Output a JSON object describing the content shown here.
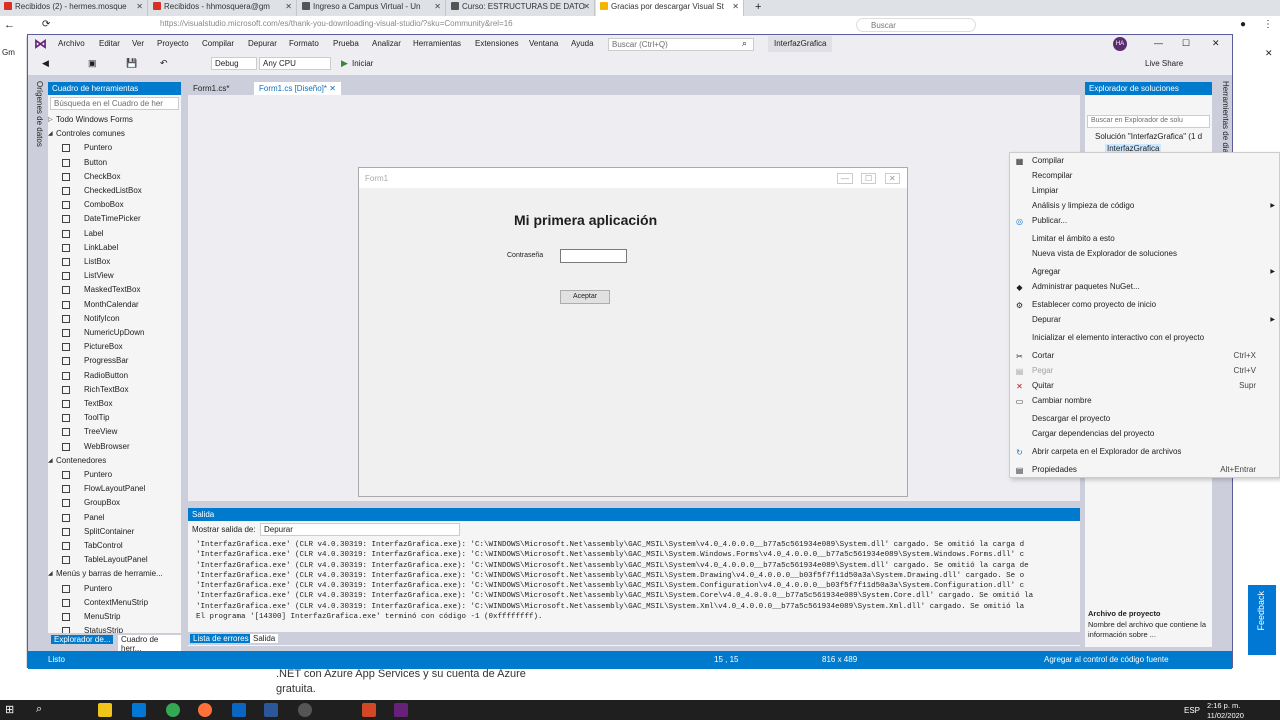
{
  "browser": {
    "tabs": [
      {
        "label": "Recibidos (2) - hermes.mosque",
        "color": "#d93025"
      },
      {
        "label": "Recibidos - hhmosquera@gm",
        "color": "#d93025"
      },
      {
        "label": "Ingreso a Campus Virtual - Un",
        "color": "#555555"
      },
      {
        "label": "Curso: ESTRUCTURAS DE DATO",
        "color": "#555555"
      },
      {
        "label": "Gracias por descargar Visual St",
        "color": "#f4b400"
      }
    ],
    "new_tab": "+",
    "address": "https://visualstudio.microsoft.com/es/thank-you-downloading-visual-studio/?sku=Community&rel=16",
    "search_placeholder": "Buscar",
    "gmail_short": "Gm"
  },
  "vs": {
    "menus": [
      "Archivo",
      "Editar",
      "Ver",
      "Proyecto",
      "Compilar",
      "Depurar",
      "Formato",
      "Prueba",
      "Analizar",
      "Herramientas",
      "Extensiones",
      "Ventana",
      "Ayuda"
    ],
    "search_placeholder": "Buscar (Ctrl+Q)",
    "solution_name": "InterfazGrafica",
    "user_initials": "HA",
    "live_share": "Live Share",
    "config": "Debug",
    "platform": "Any CPU",
    "start_label": "Iniciar",
    "left_rail_label": "Orígenes de datos",
    "right_rail_label": "Herramientas de diagnóstico"
  },
  "toolbox": {
    "title": "Cuadro de herramientas",
    "search_placeholder": "Búsqueda en el Cuadro de her",
    "categories": [
      {
        "label": "Todo Windows Forms",
        "expanded": false,
        "top": 0
      },
      {
        "label": "Controles comunes",
        "expanded": true
      }
    ],
    "common_items": [
      "Puntero",
      "Button",
      "CheckBox",
      "CheckedListBox",
      "ComboBox",
      "DateTimePicker",
      "Label",
      "LinkLabel",
      "ListBox",
      "ListView",
      "MaskedTextBox",
      "MonthCalendar",
      "NotifyIcon",
      "NumericUpDown",
      "PictureBox",
      "ProgressBar",
      "RadioButton",
      "RichTextBox",
      "TextBox",
      "ToolTip",
      "TreeView",
      "WebBrowser"
    ],
    "containers_label": "Contenedores",
    "container_items": [
      "Puntero",
      "FlowLayoutPanel",
      "GroupBox",
      "Panel",
      "SplitContainer",
      "TabControl",
      "TableLayoutPanel"
    ],
    "menus_label": "Menús y barras de herramie...",
    "menu_items": [
      "Puntero",
      "ContextMenuStrip",
      "MenuStrip",
      "StatusStrip"
    ],
    "bottom_tabs": [
      "Explorador de...",
      "Cuadro de herr..."
    ]
  },
  "document": {
    "tabs": [
      "Form1.cs*",
      "Form1.cs [Diseño]*"
    ],
    "form_title": "Form1",
    "heading": "Mi primera aplicación",
    "password_label": "Contraseña",
    "button_label": "Aceptar"
  },
  "output": {
    "title": "Salida",
    "show_from_label": "Mostrar salida de:",
    "show_from_value": "Depurar",
    "lines": [
      "'InterfazGrafica.exe' (CLR v4.0.30319: InterfazGrafica.exe): 'C:\\WINDOWS\\Microsoft.Net\\assembly\\GAC_MSIL\\System\\v4.0_4.0.0.0__b77a5c561934e089\\System.dll' cargado. Se omitió la carga d",
      "'InterfazGrafica.exe' (CLR v4.0.30319: InterfazGrafica.exe): 'C:\\WINDOWS\\Microsoft.Net\\assembly\\GAC_MSIL\\System.Windows.Forms\\v4.0_4.0.0.0__b77a5c561934e089\\System.Windows.Forms.dll' c",
      "'InterfazGrafica.exe' (CLR v4.0.30319: InterfazGrafica.exe): 'C:\\WINDOWS\\Microsoft.Net\\assembly\\GAC_MSIL\\System\\v4.0_4.0.0.0__b77a5c561934e089\\System.dll' cargado. Se omitió la carga de",
      "'InterfazGrafica.exe' (CLR v4.0.30319: InterfazGrafica.exe): 'C:\\WINDOWS\\Microsoft.Net\\assembly\\GAC_MSIL\\System.Drawing\\v4.0_4.0.0.0__b03f5f7f11d50a3a\\System.Drawing.dll' cargado. Se o",
      "'InterfazGrafica.exe' (CLR v4.0.30319: InterfazGrafica.exe): 'C:\\WINDOWS\\Microsoft.Net\\assembly\\GAC_MSIL\\System.Configuration\\v4.0_4.0.0.0__b03f5f7f11d50a3a\\System.Configuration.dll' c",
      "'InterfazGrafica.exe' (CLR v4.0.30319: InterfazGrafica.exe): 'C:\\WINDOWS\\Microsoft.Net\\assembly\\GAC_MSIL\\System.Core\\v4.0_4.0.0.0__b77a5c561934e089\\System.Core.dll' cargado. Se omitió la",
      "'InterfazGrafica.exe' (CLR v4.0.30319: InterfazGrafica.exe): 'C:\\WINDOWS\\Microsoft.Net\\assembly\\GAC_MSIL\\System.Xml\\v4.0_4.0.0.0__b77a5c561934e089\\System.Xml.dll' cargado. Se omitió la",
      "El programa '[14300] InterfazGrafica.exe' terminó con código -1 (0xffffffff)."
    ],
    "bottom_tabs": [
      "Lista de errores",
      "Salida"
    ]
  },
  "solution_explorer": {
    "title": "Explorador de soluciones",
    "search_placeholder": "Buscar en Explorador de solu",
    "solution_item": "Solución \"InterfazGrafica\" (1 d",
    "project_item": "InterfazGrafica",
    "props_title": "Archivo de proyecto",
    "props_desc": "Nombre del archivo que contiene la información sobre ..."
  },
  "context_menu": [
    {
      "label": "Compilar",
      "icon": "build-icon"
    },
    {
      "label": "Recompilar"
    },
    {
      "label": "Limpiar"
    },
    {
      "label": "Análisis y limpieza de código",
      "submenu": true
    },
    {
      "label": "Publicar...",
      "icon": "globe-icon"
    },
    {
      "label": "Limitar el ámbito a esto"
    },
    {
      "label": "Nueva vista de Explorador de soluciones"
    },
    {
      "label": "Agregar",
      "submenu": true
    },
    {
      "label": "Administrar paquetes NuGet...",
      "icon": "nuget-icon"
    },
    {
      "label": "Establecer como proyecto de inicio",
      "icon": "gear-icon"
    },
    {
      "label": "Depurar",
      "submenu": true
    },
    {
      "label": "Inicializar el elemento interactivo con el proyecto"
    },
    {
      "label": "Cortar",
      "shortcut": "Ctrl+X",
      "icon": "scissors-icon"
    },
    {
      "label": "Pegar",
      "shortcut": "Ctrl+V",
      "disabled": true,
      "icon": "paste-icon"
    },
    {
      "label": "Quitar",
      "shortcut": "Supr",
      "icon": "delete-icon"
    },
    {
      "label": "Cambiar nombre",
      "icon": "rename-icon"
    },
    {
      "label": "Descargar el proyecto"
    },
    {
      "label": "Cargar dependencias del proyecto"
    },
    {
      "label": "Abrir carpeta en el Explorador de archivos",
      "icon": "refresh-folder-icon"
    },
    {
      "label": "Propiedades",
      "shortcut": "Alt+Entrar",
      "icon": "properties-icon"
    }
  ],
  "status": {
    "ready": "Listo",
    "position": "15 , 15",
    "size": "816 x 489",
    "source_control": "Agregar al control de código fuente"
  },
  "web": {
    "text": ".NET con Azure App Services y su cuenta de Azure gratuita."
  },
  "feedback": "Feedback",
  "taskbar": {
    "lang": "ESP",
    "time": "2:16 p. m.",
    "date": "11/02/2020"
  }
}
